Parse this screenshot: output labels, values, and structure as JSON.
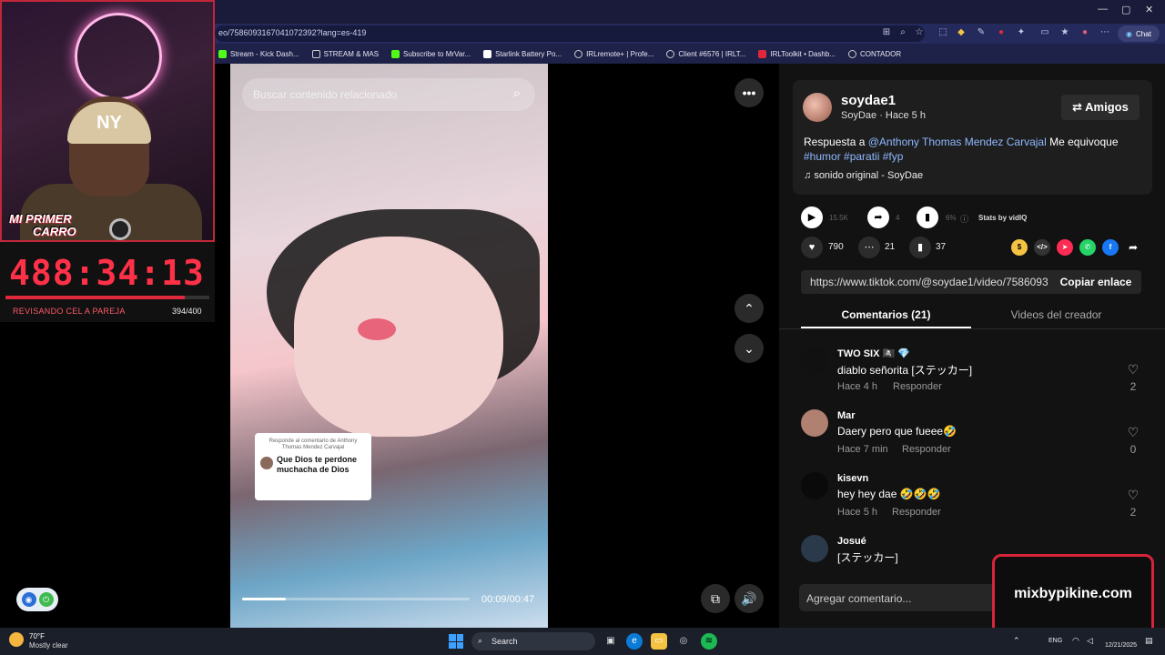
{
  "browser": {
    "url": "eo/7586093167041072392?lang=es-419",
    "chat_label": "Chat",
    "bookmarks": [
      {
        "label": "Stream - Kick Dash...",
        "color": "#53fc18"
      },
      {
        "label": "STREAM & MAS",
        "color": "#cccccc"
      },
      {
        "label": "Subscribe to MrVar...",
        "color": "#53fc18"
      },
      {
        "label": "Starlink Battery Po...",
        "color": "#ffffff"
      },
      {
        "label": "IRLremote+ | Profe...",
        "color": "#cccccc"
      },
      {
        "label": "Client #6576 | IRLT...",
        "color": "#cccccc"
      },
      {
        "label": "IRLToolkit • Dashb...",
        "color": "#e0283c"
      },
      {
        "label": "CONTADOR",
        "color": "#cccccc"
      }
    ]
  },
  "overlay": {
    "badge_line1": "MI PRIMER",
    "badge_line2": "CARRO",
    "timer": "488:34:13",
    "goal_label": "REVISANDO CEL A PAREJA",
    "goal_count": "394/400",
    "goal_progress": 0.985
  },
  "video": {
    "search_placeholder": "Buscar contenido relacionado",
    "reply_small": "Responde al comentario de Anthony Thomas Mendez Carvajal",
    "reply_main": "Que Dios te perdone muchacha de Dios",
    "time": "00:09/00:47",
    "progress": 0.19
  },
  "post": {
    "username": "soydae1",
    "subline": "SoyDae · Hace 5 h",
    "friends_label": "Amigos",
    "desc_prefix": "Respuesta a ",
    "mention": "@Anthony Thomas Mendez Carvajal",
    "desc_text": " Me equivoque ",
    "tags": "#humor #paratii #fyp",
    "sound": "sonido original - SoyDae",
    "views": "15.5K",
    "shares_stat": "4",
    "engagement": "6%",
    "stats_by": "Stats by vidIQ",
    "likes": "790",
    "comments": "21",
    "saves": "37",
    "link": "https://www.tiktok.com/@soydae1/video/7586093...",
    "copy_label": "Copiar enlace",
    "tab_comments": "Comentarios (21)",
    "tab_videos": "Videos del creador",
    "add_comment_placeholder": "Agregar comentario..."
  },
  "comments": [
    {
      "name": "TWO        SIX 🏴‍☠️ 💎",
      "text": "diablo señorita [ステッカー]",
      "time": "Hace 4 h",
      "reply": "Responder",
      "likes": "2",
      "avatar": "#111111"
    },
    {
      "name": "Mar",
      "text": "Daery pero que fueee🤣",
      "time": "Hace 7 min",
      "reply": "Responder",
      "likes": "0",
      "avatar": "#b08070"
    },
    {
      "name": "kisevn",
      "text": "hey hey dae 🤣🤣🤣",
      "time": "Hace 5 h",
      "reply": "Responder",
      "likes": "2",
      "avatar": "#0a0a0a"
    },
    {
      "name": "Josué",
      "text": "[ステッカー]",
      "time": "",
      "reply": "",
      "likes": "",
      "avatar": "#2a3a4a"
    }
  ],
  "brand": "mixbypikine.com",
  "taskbar": {
    "temp": "70°F",
    "weather": "Mostly clear",
    "search": "Search",
    "lang": "ENG",
    "date": "12/21/2025"
  }
}
